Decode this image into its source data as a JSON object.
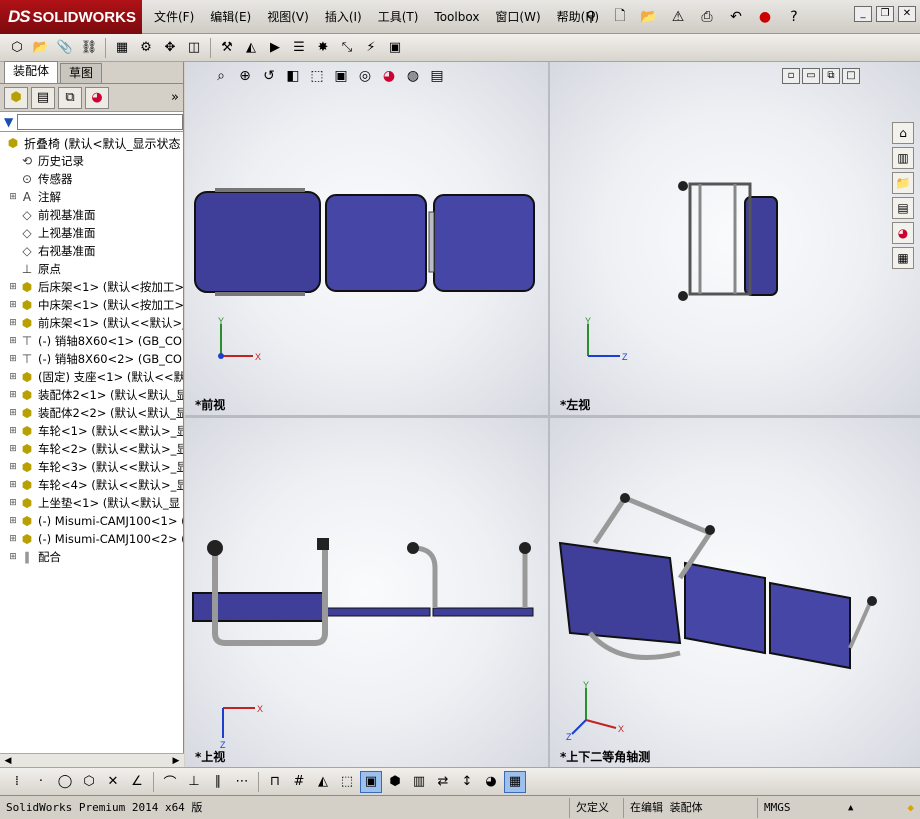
{
  "app": {
    "brand_ds": "DS",
    "brand": "SOLIDWORKS"
  },
  "menu": [
    "文件(F)",
    "编辑(E)",
    "视图(V)",
    "插入(I)",
    "工具(T)",
    "Toolbox",
    "窗口(W)",
    "帮助(H)"
  ],
  "left_panel": {
    "tabs": [
      "装配体",
      "草图"
    ],
    "tree": [
      {
        "label": "折叠椅  (默认<默认_显示状态",
        "type": "asm",
        "root": true
      },
      {
        "label": "历史记录",
        "type": "history"
      },
      {
        "label": "传感器",
        "type": "sensor"
      },
      {
        "label": "注解",
        "type": "note",
        "expand": true
      },
      {
        "label": "前视基准面",
        "type": "plane"
      },
      {
        "label": "上视基准面",
        "type": "plane"
      },
      {
        "label": "右视基准面",
        "type": "plane"
      },
      {
        "label": "原点",
        "type": "origin"
      },
      {
        "label": "后床架<1> (默认<按加工>",
        "type": "asm",
        "expand": true
      },
      {
        "label": "中床架<1> (默认<按加工>",
        "type": "asm",
        "expand": true
      },
      {
        "label": "前床架<1> (默认<<默认>_",
        "type": "asm",
        "expand": true
      },
      {
        "label": "(-) 销轴8X60<1> (GB_CON",
        "type": "pin",
        "expand": true
      },
      {
        "label": "(-) 销轴8X60<2> (GB_CON",
        "type": "pin",
        "expand": true
      },
      {
        "label": "(固定) 支座<1> (默认<<默",
        "type": "asm",
        "expand": true
      },
      {
        "label": "装配体2<1> (默认<默认_显",
        "type": "asm",
        "expand": true
      },
      {
        "label": "装配体2<2> (默认<默认_显",
        "type": "asm",
        "expand": true
      },
      {
        "label": "车轮<1> (默认<<默认>_显",
        "type": "asm",
        "expand": true
      },
      {
        "label": "车轮<2> (默认<<默认>_显",
        "type": "asm",
        "expand": true
      },
      {
        "label": "车轮<3> (默认<<默认>_显",
        "type": "asm",
        "expand": true
      },
      {
        "label": "车轮<4> (默认<<默认>_显",
        "type": "asm",
        "expand": true
      },
      {
        "label": "上坐垫<1> (默认<默认_显",
        "type": "asm",
        "expand": true
      },
      {
        "label": "(-) Misumi-CAMJ100<1> (",
        "type": "asm",
        "expand": true
      },
      {
        "label": "(-) Misumi-CAMJ100<2> (",
        "type": "asm",
        "expand": true
      },
      {
        "label": "配合",
        "type": "mate",
        "expand": true
      }
    ]
  },
  "viewports": {
    "front": "*前视",
    "left": "*左视",
    "top": "*上视",
    "iso": "*上下二等角轴测"
  },
  "triad": {
    "x": "X",
    "y": "Y",
    "z": "Z"
  },
  "status": {
    "version": "SolidWorks Premium 2014 x64 版",
    "mode": "欠定义",
    "editing": "在编辑 装配体",
    "units": "MMGS"
  },
  "colors": {
    "seat": "#3f3f99",
    "frame": "#b8bcc4",
    "brand": "#b11217"
  }
}
